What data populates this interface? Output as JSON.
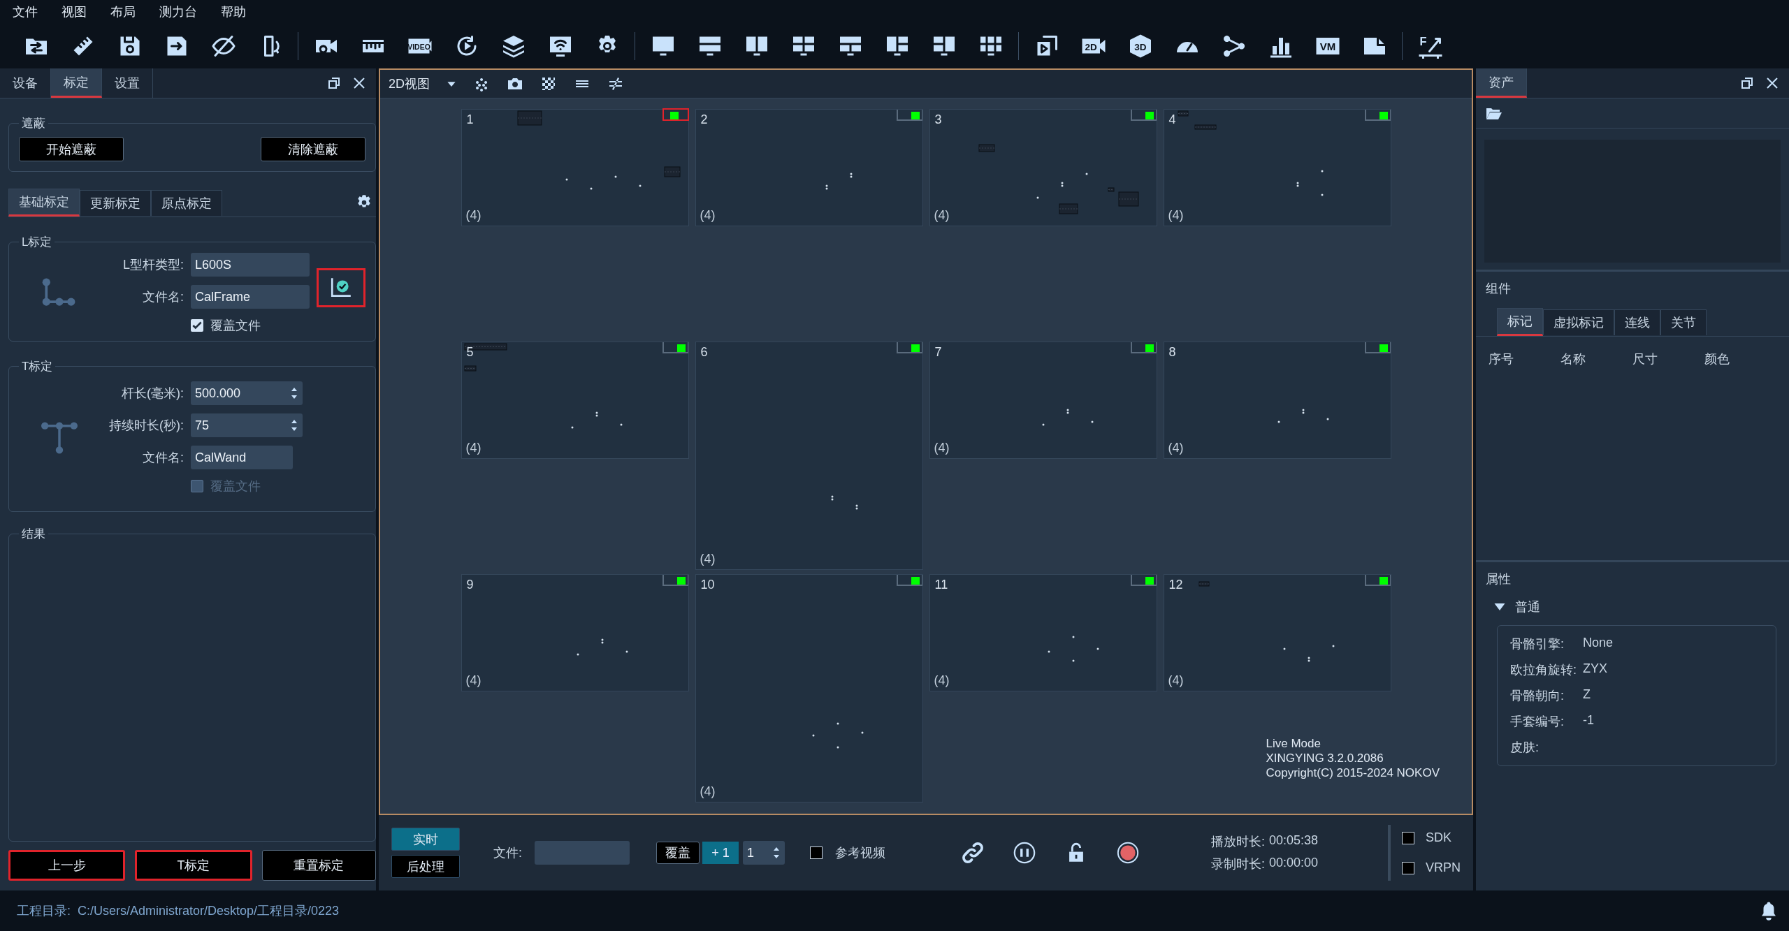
{
  "menu": [
    "文件",
    "视图",
    "布局",
    "测力台",
    "帮助"
  ],
  "toolbar": [
    [
      {
        "kind": "open-folder"
      },
      {
        "kind": "ruler"
      },
      {
        "kind": "save"
      },
      {
        "kind": "save-as"
      },
      {
        "kind": "eye-off"
      },
      {
        "kind": "device-rotate"
      }
    ],
    [
      {
        "kind": "camera-video"
      },
      {
        "kind": "ruler-bar"
      },
      {
        "kind": "video",
        "label": "VIDEO"
      },
      {
        "kind": "replay"
      },
      {
        "kind": "layers"
      },
      {
        "kind": "wifi-monitor"
      },
      {
        "kind": "gear"
      }
    ],
    [
      {
        "kind": "monitor"
      },
      {
        "kind": "monitor-2h"
      },
      {
        "kind": "monitor-2v"
      },
      {
        "kind": "monitor-4"
      },
      {
        "kind": "monitor-3t"
      },
      {
        "kind": "monitor-3l"
      },
      {
        "kind": "monitor-3r"
      },
      {
        "kind": "monitor-6"
      }
    ],
    [
      {
        "kind": "play-frame"
      },
      {
        "kind": "cam-label",
        "label": "2D"
      },
      {
        "kind": "hex-label",
        "label": "3D"
      },
      {
        "kind": "gauge"
      },
      {
        "kind": "share"
      },
      {
        "kind": "bar-chart"
      },
      {
        "kind": "box-label",
        "label": "VM"
      },
      {
        "kind": "document"
      }
    ],
    [
      {
        "kind": "force-plate",
        "label": "F"
      }
    ]
  ],
  "left_panel": {
    "tabs": [
      {
        "label": "设备",
        "selected": false
      },
      {
        "label": "标定",
        "selected": true
      },
      {
        "label": "设置",
        "selected": false
      }
    ],
    "mask": {
      "title": "遮蔽",
      "buttons": [
        "开始遮蔽",
        "清除遮蔽"
      ]
    },
    "sub_tabs": [
      {
        "label": "基础标定",
        "selected": true
      },
      {
        "label": "更新标定",
        "selected": false
      },
      {
        "label": "原点标定",
        "selected": false
      }
    ],
    "l_calibration": {
      "title": "L标定",
      "fields": [
        {
          "label": "L型杆类型:",
          "value": "L600S"
        },
        {
          "label": "文件名:",
          "value": "CalFrame"
        }
      ],
      "overwrite": {
        "label": "覆盖文件",
        "checked": true,
        "disabled": false
      },
      "action_highlighted": true
    },
    "t_calibration": {
      "title": "T标定",
      "fields": [
        {
          "label": "杆长(毫米):",
          "value": "500.000",
          "kind": "spin"
        },
        {
          "label": "持续时长(秒):",
          "value": "75",
          "kind": "spin"
        },
        {
          "label": "文件名:",
          "value": "CalWand",
          "kind": "text"
        }
      ],
      "overwrite": {
        "label": "覆盖文件",
        "checked": false,
        "disabled": true
      }
    },
    "result": {
      "title": "结果"
    },
    "buttons": [
      {
        "label": "上一步",
        "highlighted": true
      },
      {
        "label": "T标定",
        "highlighted": true
      },
      {
        "label": "重置标定",
        "highlighted": false
      }
    ]
  },
  "view": {
    "mode": "2D视图",
    "tools": [
      {
        "kind": "dots"
      },
      {
        "kind": "camera"
      },
      {
        "kind": "checker"
      },
      {
        "kind": "lines"
      },
      {
        "kind": "not-equal"
      }
    ],
    "cameras": [
      {
        "number": "1",
        "count": "(4)",
        "active": true,
        "highlighted": true,
        "tall": false
      },
      {
        "number": "2",
        "count": "(4)",
        "active": true,
        "highlighted": false,
        "tall": false
      },
      {
        "number": "3",
        "count": "(4)",
        "active": true,
        "highlighted": false,
        "tall": false
      },
      {
        "number": "4",
        "count": "(4)",
        "active": true,
        "highlighted": false,
        "tall": false
      },
      {
        "number": "5",
        "count": "(4)",
        "active": true,
        "highlighted": false,
        "tall": false
      },
      {
        "number": "6",
        "count": "(4)",
        "active": true,
        "highlighted": false,
        "tall": true
      },
      {
        "number": "7",
        "count": "(4)",
        "active": true,
        "highlighted": false,
        "tall": false
      },
      {
        "number": "8",
        "count": "(4)",
        "active": true,
        "highlighted": false,
        "tall": false
      },
      {
        "number": "9",
        "count": "(4)",
        "active": true,
        "highlighted": false,
        "tall": false
      },
      {
        "number": "10",
        "count": "(4)",
        "active": true,
        "highlighted": false,
        "tall": true
      },
      {
        "number": "11",
        "count": "(4)",
        "active": true,
        "highlighted": false,
        "tall": false
      },
      {
        "number": "12",
        "count": "(4)",
        "active": true,
        "highlighted": false,
        "tall": false
      }
    ],
    "info": [
      "Live Mode",
      "XINGYING 3.2.0.2086",
      "Copyright(C) 2015-2024 NOKOV"
    ]
  },
  "playback": {
    "modes": [
      {
        "label": "实时",
        "selected": true
      },
      {
        "label": "后处理",
        "selected": false
      }
    ],
    "file_label": "文件:",
    "overwrite_button": "覆盖",
    "step_button": "+ 1",
    "step_value": "1",
    "reference_video": {
      "label": "参考视频",
      "checked": false
    },
    "times": [
      {
        "label": "播放时长:",
        "value": "00:05:38"
      },
      {
        "label": "录制时长:",
        "value": "00:00:00"
      }
    ],
    "outputs": [
      {
        "label": "SDK",
        "checked": false
      },
      {
        "label": "VRPN",
        "checked": false
      }
    ]
  },
  "right_panel": {
    "tabs": [
      {
        "label": "资产",
        "selected": true
      }
    ],
    "components_title": "组件",
    "component_tabs": [
      {
        "label": "标记",
        "selected": true
      },
      {
        "label": "虚拟标记",
        "selected": false
      },
      {
        "label": "连线",
        "selected": false
      },
      {
        "label": "关节",
        "selected": false
      }
    ],
    "columns": [
      "序号",
      "名称",
      "尺寸",
      "颜色"
    ],
    "properties_title": "属性",
    "group": {
      "label": "普通",
      "expanded": true,
      "rows": [
        {
          "label": "骨骼引擎:",
          "value": "None"
        },
        {
          "label": "欧拉角旋转:",
          "value": "ZYX"
        },
        {
          "label": "骨骼朝向:",
          "value": "Z"
        },
        {
          "label": "手套编号:",
          "value": "-1"
        },
        {
          "label": "皮肤:"
        }
      ]
    }
  },
  "status_bar": {
    "label": "工程目录:",
    "path": "C:/Users/Administrator/Desktop/工程目录/0223"
  }
}
